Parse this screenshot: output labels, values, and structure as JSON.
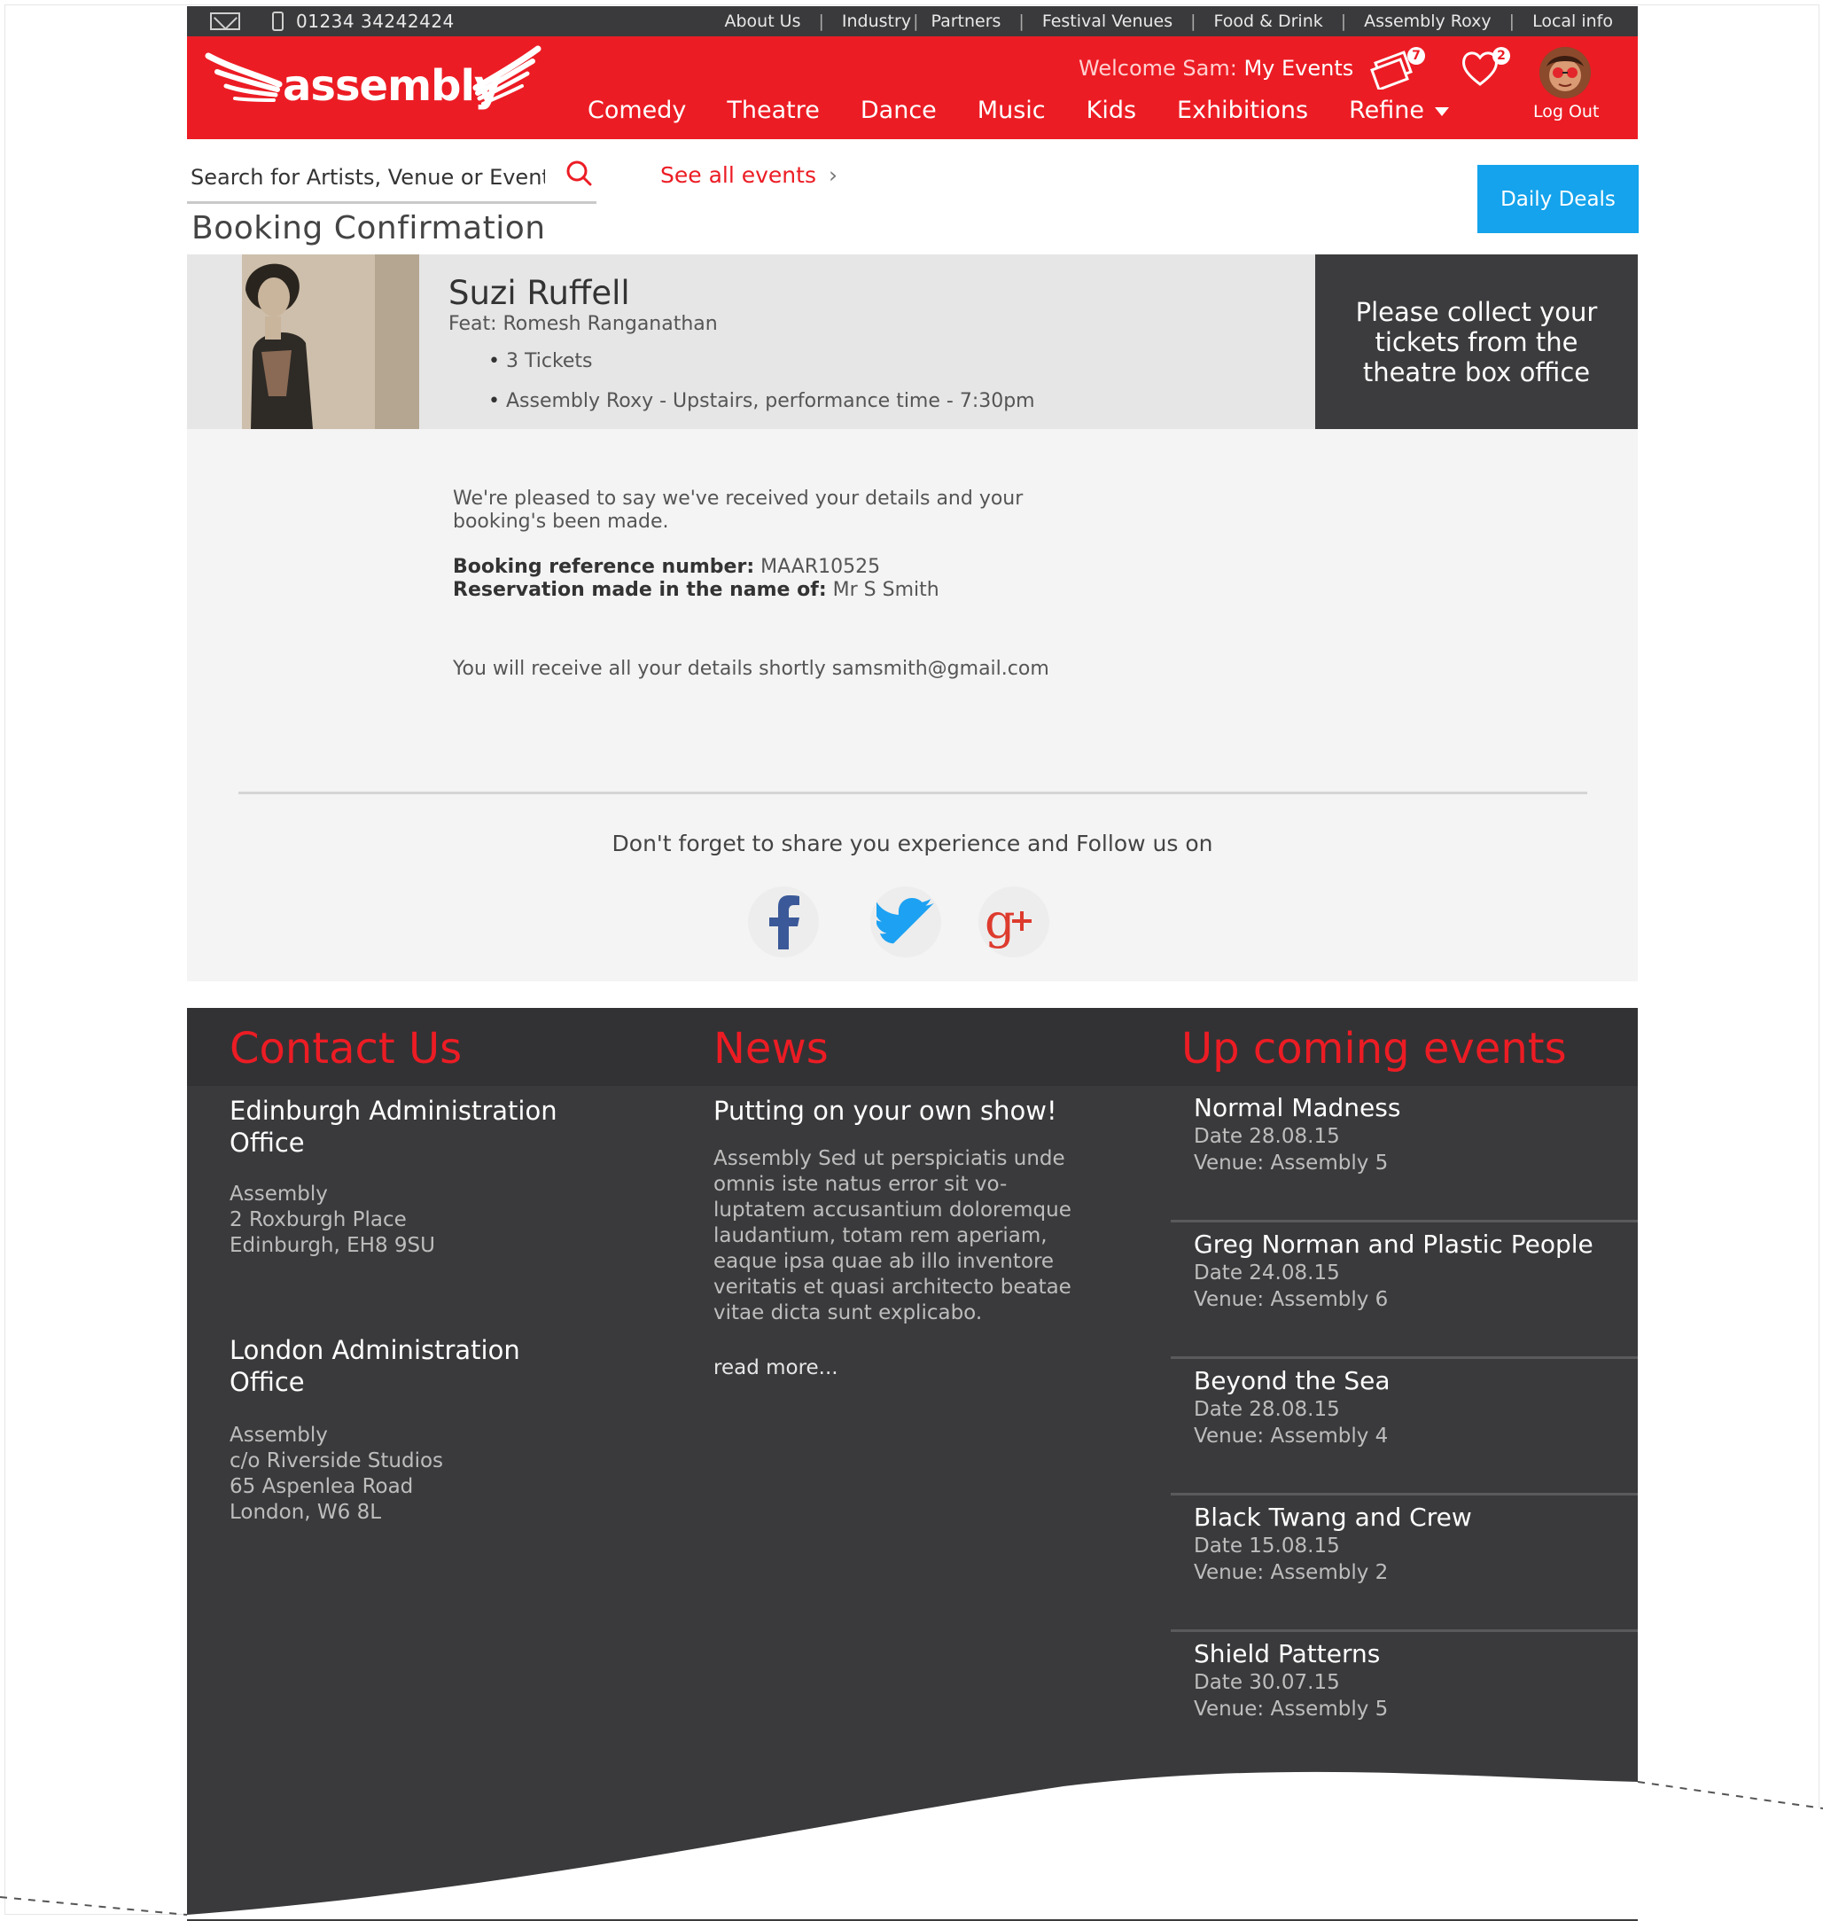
{
  "topbar": {
    "phone": "01234 34242424",
    "links": [
      "About Us",
      "Industry",
      "Partners",
      "Festival Venues",
      "Food & Drink",
      "Assembly Roxy",
      "Local info"
    ]
  },
  "header": {
    "logo_text": "assembly",
    "welcome_prefix": "Welcome Sam:",
    "my_events": "My Events",
    "tickets_count": "7",
    "favourites_count": "2",
    "logout": "Log Out",
    "nav": [
      "Comedy",
      "Theatre",
      "Dance",
      "Music",
      "Kids",
      "Exhibitions",
      "Refine"
    ]
  },
  "search": {
    "placeholder": "Search for Artists, Venue or Event",
    "see_all": "See all events"
  },
  "daily_deals": "Daily Deals",
  "page_title": "Booking Confirmation",
  "booking": {
    "artist": "Suzi Ruffell",
    "feat": "Feat: Romesh Ranganathan",
    "details": [
      "3 Tickets",
      "Assembly Roxy - Upstairs, performance time - 7:30pm"
    ],
    "collect_notice": "Please collect your tickets from the theatre box office",
    "message_line1": "We're pleased to say we've received your details and your",
    "message_line2": "booking's been made.",
    "ref_label": "Booking reference number:",
    "ref_value": "MAAR10525",
    "name_label": "Reservation made in the name of:",
    "name_value": "Mr S Smith",
    "email_notice": "You will receive all your details shortly samsmith@gmail.com",
    "follow_text": "Don't forget to share you experience and Follow us on"
  },
  "footer": {
    "contact_title": "Contact Us",
    "news_title": "News",
    "events_title": "Up coming events",
    "offices": [
      {
        "title_1": "Edinburgh Administration",
        "title_2": "Office",
        "lines": [
          "Assembly",
          "2 Roxburgh Place",
          "Edinburgh, EH8 9SU"
        ]
      },
      {
        "title_1": "London Administration",
        "title_2": "Office",
        "lines": [
          "Assembly",
          "c/o Riverside Studios",
          "65 Aspenlea Road",
          "London, W6 8L"
        ]
      }
    ],
    "news": {
      "headline": "Putting on your own show!",
      "lines": [
        "Assembly Sed ut perspiciatis unde",
        "omnis iste natus error sit vo-",
        "luptatem accusantium doloremque",
        "laudantium, totam rem aperiam,",
        "eaque ipsa quae ab illo inventore",
        "veritatis et quasi architecto beatae",
        "vitae dicta sunt explicabo."
      ],
      "read_more": "read more..."
    },
    "events": [
      {
        "name": "Normal Madness",
        "date": "Date 28.08.15",
        "venue": "Venue: Assembly 5"
      },
      {
        "name": "Greg Norman and Plastic People",
        "date": "Date 24.08.15",
        "venue": "Venue: Assembly 6"
      },
      {
        "name": "Beyond the Sea",
        "date": "Date 28.08.15",
        "venue": "Venue: Assembly 4"
      },
      {
        "name": "Black Twang and Crew",
        "date": "Date 15.08.15",
        "venue": "Venue: Assembly 2"
      },
      {
        "name": "Shield Patterns",
        "date": "Date 30.07.15",
        "venue": "Venue: Assembly 5"
      }
    ]
  },
  "colors": {
    "brand_red": "#ec1c24",
    "dark": "#3a3a3c",
    "deals_blue": "#14a3ec"
  }
}
